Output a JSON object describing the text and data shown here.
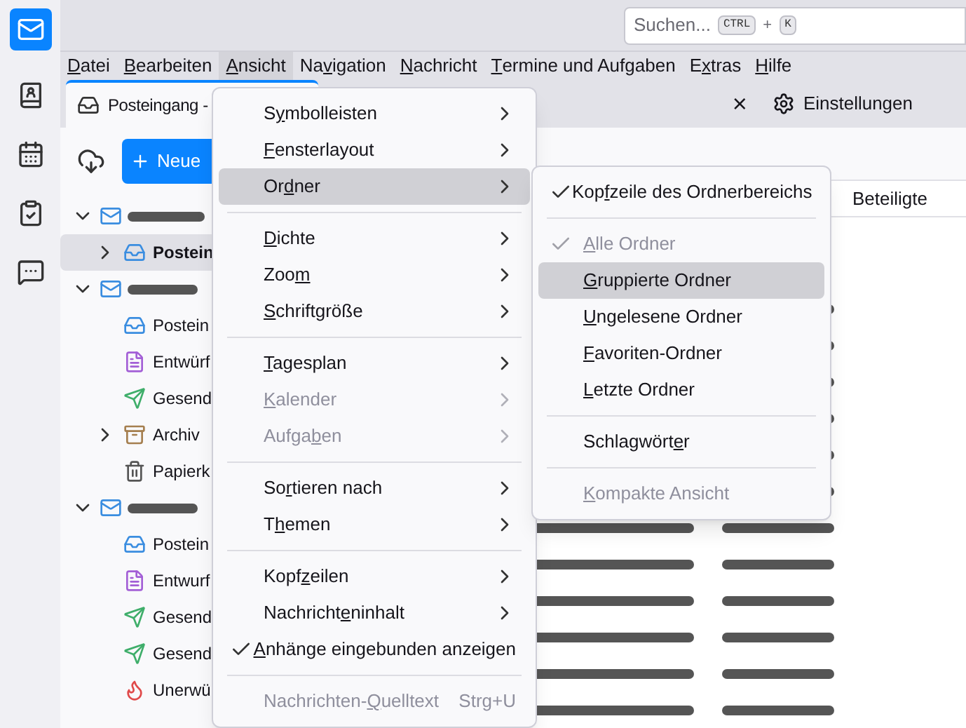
{
  "search": {
    "placeholder": "Suchen...",
    "shortcut": [
      "CTRL",
      "+",
      "K"
    ]
  },
  "menubar": [
    {
      "label": {
        "key": "D",
        "post": "atei"
      },
      "selected": false
    },
    {
      "label": {
        "key": "B",
        "post": "earbeiten"
      },
      "selected": false
    },
    {
      "label": {
        "key": "A",
        "post": "nsicht"
      },
      "selected": true
    },
    {
      "label": {
        "pre": "Na",
        "key": "v",
        "post": "igation"
      },
      "selected": false
    },
    {
      "label": {
        "key": "N",
        "post": "achricht"
      },
      "selected": false
    },
    {
      "label": {
        "key": "T",
        "post": "ermine und Aufgaben"
      },
      "selected": false
    },
    {
      "label": {
        "pre": "E",
        "key": "x",
        "post": "tras"
      },
      "selected": false
    },
    {
      "label": {
        "key": "H",
        "post": "ilfe"
      },
      "selected": false
    }
  ],
  "tab": {
    "title": "Posteingang -"
  },
  "toolbar": {
    "new_button": "Neue",
    "close": "×",
    "settings": "Einstellungen"
  },
  "folders": [
    {
      "kind": "account",
      "expanded": true,
      "children": [
        {
          "kind": "inbox",
          "name": "Postein",
          "selected": true,
          "expanded": false
        }
      ]
    },
    {
      "kind": "account",
      "expanded": true,
      "children": [
        {
          "kind": "inbox",
          "name": "Postein",
          "selected": false
        },
        {
          "kind": "drafts",
          "name": "Entwürf",
          "selected": false
        },
        {
          "kind": "sent",
          "name": "Gesend",
          "selected": false
        },
        {
          "kind": "archive",
          "name": "Archiv",
          "selected": false,
          "expanded": false
        },
        {
          "kind": "trash",
          "name": "Papierk",
          "selected": false
        }
      ]
    },
    {
      "kind": "account",
      "expanded": true,
      "children": [
        {
          "kind": "inbox",
          "name": "Postein",
          "selected": false
        },
        {
          "kind": "drafts",
          "name": "Entwurf",
          "selected": false
        },
        {
          "kind": "sent",
          "name": "Gesend",
          "selected": false
        },
        {
          "kind": "sent",
          "name": "Gesend",
          "selected": false
        },
        {
          "kind": "junk",
          "name": "Unerwü",
          "selected": false
        }
      ]
    }
  ],
  "message_list": {
    "column": "Beteiligte"
  },
  "view_menu": [
    {
      "kind": "item",
      "label": {
        "pre": "S",
        "key": "y",
        "post": "mbolleisten"
      },
      "submenu": true,
      "disabled": false,
      "selected": false
    },
    {
      "kind": "item",
      "label": {
        "key": "F",
        "post": "ensterlayout"
      },
      "submenu": true,
      "disabled": false,
      "selected": false
    },
    {
      "kind": "item",
      "label": {
        "pre": "Or",
        "key": "d",
        "post": "ner"
      },
      "submenu": true,
      "disabled": false,
      "selected": true
    },
    {
      "kind": "separator"
    },
    {
      "kind": "item",
      "label": {
        "key": "D",
        "post": "ichte"
      },
      "submenu": true,
      "disabled": false,
      "selected": false
    },
    {
      "kind": "item",
      "label": {
        "pre": "Zoo",
        "key": "m"
      },
      "submenu": true,
      "disabled": false,
      "selected": false
    },
    {
      "kind": "item",
      "label": {
        "key": "S",
        "post": "chriftgröße"
      },
      "submenu": true,
      "disabled": false,
      "selected": false
    },
    {
      "kind": "separator"
    },
    {
      "kind": "item",
      "label": {
        "key": "T",
        "post": "agesplan"
      },
      "submenu": true,
      "disabled": false,
      "selected": false
    },
    {
      "kind": "item",
      "label": {
        "key": "K",
        "post": "alender"
      },
      "submenu": true,
      "disabled": true,
      "selected": false
    },
    {
      "kind": "item",
      "label": {
        "pre": "Aufga",
        "key": "b",
        "post": "en"
      },
      "submenu": true,
      "disabled": true,
      "selected": false
    },
    {
      "kind": "separator"
    },
    {
      "kind": "item",
      "label": {
        "pre": "So",
        "key": "r",
        "post": "tieren nach"
      },
      "submenu": true,
      "disabled": false,
      "selected": false
    },
    {
      "kind": "item",
      "label": {
        "pre": "T",
        "key": "h",
        "post": "emen"
      },
      "submenu": true,
      "disabled": false,
      "selected": false
    },
    {
      "kind": "separator"
    },
    {
      "kind": "item",
      "label": {
        "pre": "Kopf",
        "key": "z",
        "post": "eilen"
      },
      "submenu": true,
      "disabled": false,
      "selected": false
    },
    {
      "kind": "item",
      "label": {
        "pre": "Nachricht",
        "key": "e",
        "post": "ninhalt"
      },
      "submenu": true,
      "disabled": false,
      "selected": false
    },
    {
      "kind": "check",
      "label": {
        "key": "A",
        "post": "nhänge eingebunden anzeigen"
      },
      "checked": true,
      "disabled": false,
      "selected": false
    },
    {
      "kind": "separator"
    },
    {
      "kind": "item",
      "label": {
        "pre": "Nachrichten-",
        "key": "Q",
        "post": "uelltext"
      },
      "shortcut": "Strg+U",
      "disabled": true,
      "selected": false
    }
  ],
  "folder_menu": [
    {
      "kind": "check",
      "label": {
        "pre": "Kop",
        "key": "f",
        "post": "zeile des Ordnerbereichs"
      },
      "checked": true,
      "disabled": false,
      "selected": false
    },
    {
      "kind": "separator"
    },
    {
      "kind": "check",
      "label": {
        "key": "A",
        "post": "lle Ordner"
      },
      "checked": true,
      "disabled": true,
      "selected": false
    },
    {
      "kind": "check",
      "label": {
        "key": "G",
        "post": "ruppierte Ordner"
      },
      "checked": false,
      "disabled": false,
      "selected": true
    },
    {
      "kind": "check",
      "label": {
        "key": "U",
        "post": "ngelesene Ordner"
      },
      "checked": false,
      "disabled": false,
      "selected": false
    },
    {
      "kind": "check",
      "label": {
        "key": "F",
        "post": "avoriten-Ordner"
      },
      "checked": false,
      "disabled": false,
      "selected": false
    },
    {
      "kind": "check",
      "label": {
        "key": "L",
        "post": "etzte Ordner"
      },
      "checked": false,
      "disabled": false,
      "selected": false
    },
    {
      "kind": "separator"
    },
    {
      "kind": "item",
      "label": {
        "pre": "Schlagwört",
        "key": "e",
        "post": "r"
      },
      "submenu": false,
      "disabled": false,
      "selected": false
    },
    {
      "kind": "separator"
    },
    {
      "kind": "check",
      "label": {
        "key": "K",
        "post": "ompakte Ansicht"
      },
      "checked": false,
      "disabled": true,
      "selected": false
    }
  ]
}
